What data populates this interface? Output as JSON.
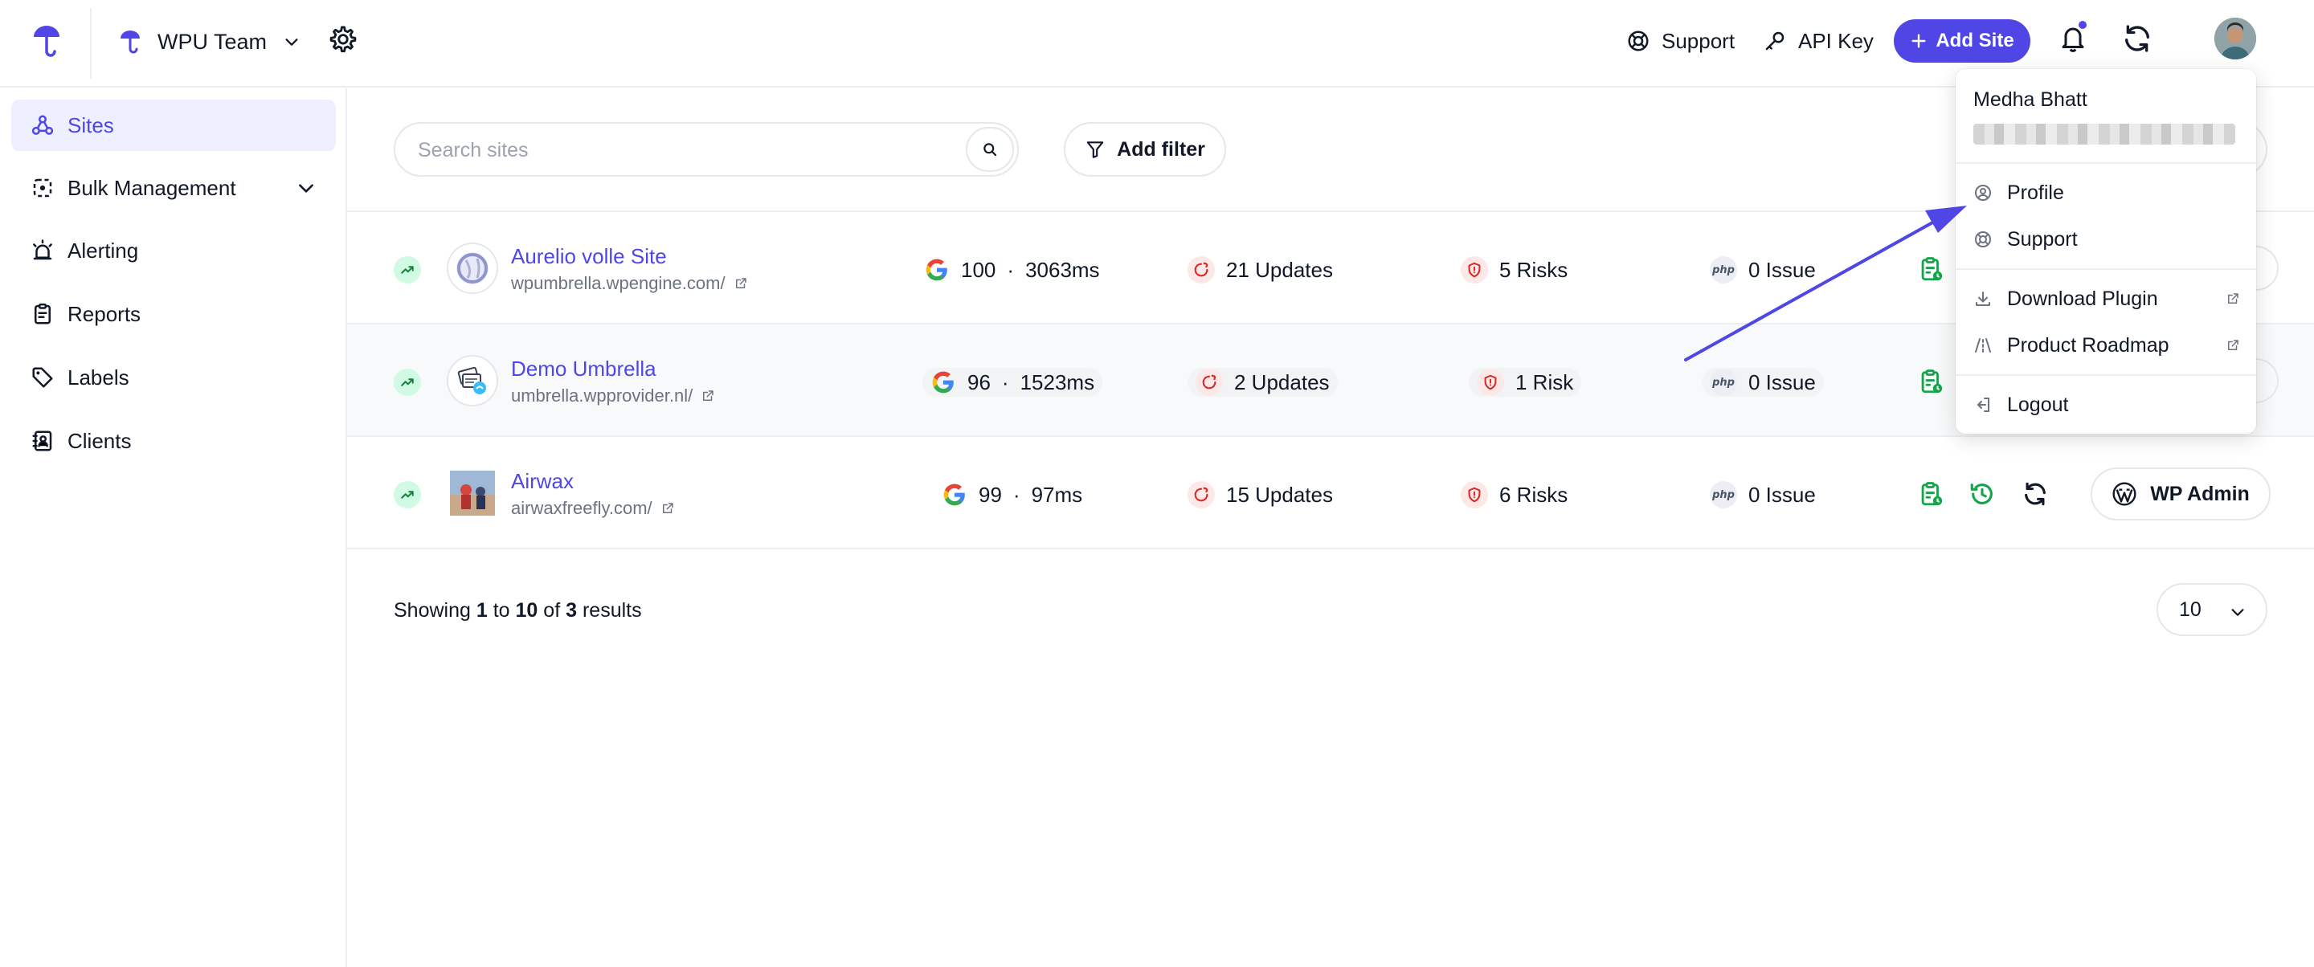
{
  "header": {
    "team_name": "WPU Team",
    "support_label": "Support",
    "api_key_label": "API Key",
    "add_site_label": "Add Site"
  },
  "sidebar": {
    "items": [
      {
        "label": "Sites",
        "icon": "sites-icon",
        "active": true
      },
      {
        "label": "Bulk Management",
        "icon": "bulk-management-icon"
      },
      {
        "label": "Alerting",
        "icon": "alert-siren-icon"
      },
      {
        "label": "Reports",
        "icon": "reports-icon"
      },
      {
        "label": "Labels",
        "icon": "tag-icon"
      },
      {
        "label": "Clients",
        "icon": "clients-icon"
      }
    ]
  },
  "toolbar": {
    "search_placeholder": "Search sites",
    "add_filter_label": "Add filter"
  },
  "sites": [
    {
      "name": "Aurelio volle Site",
      "url": "wpumbrella.wpengine.com/",
      "score": "100",
      "load_time": "3063ms",
      "updates": "21 Updates",
      "risks": "5 Risks",
      "php": "0 Issue"
    },
    {
      "name": "Demo Umbrella",
      "url": "umbrella.wpprovider.nl/",
      "score": "96",
      "load_time": "1523ms",
      "updates": "2 Updates",
      "risks": "1 Risk",
      "php": "0 Issue"
    },
    {
      "name": "Airwax",
      "url": "airwaxfreefly.com/",
      "score": "99",
      "load_time": "97ms",
      "updates": "15 Updates",
      "risks": "6 Risks",
      "php": "0 Issue",
      "wp_admin_label": "WP Admin"
    }
  ],
  "labels": {
    "separator": "·",
    "php_badge": "php"
  },
  "pagination": {
    "showing_prefix": "Showing",
    "from": "1",
    "to_word": "to",
    "to": "10",
    "of_word": "of",
    "total": "3",
    "results_word": "results",
    "per_page": "10"
  },
  "user_menu": {
    "user_name": "Medha Bhatt",
    "items": [
      {
        "label": "Profile",
        "icon": "user-circle-icon"
      },
      {
        "label": "Support",
        "icon": "lifebuoy-icon"
      },
      {
        "label": "Download Plugin",
        "icon": "download-icon",
        "external": true
      },
      {
        "label": "Product Roadmap",
        "icon": "roadmap-icon",
        "external": true
      },
      {
        "label": "Logout",
        "icon": "logout-icon"
      }
    ]
  },
  "colors": {
    "accent": "#4f46e5",
    "success": "#16a34a",
    "danger": "#dc2626"
  }
}
